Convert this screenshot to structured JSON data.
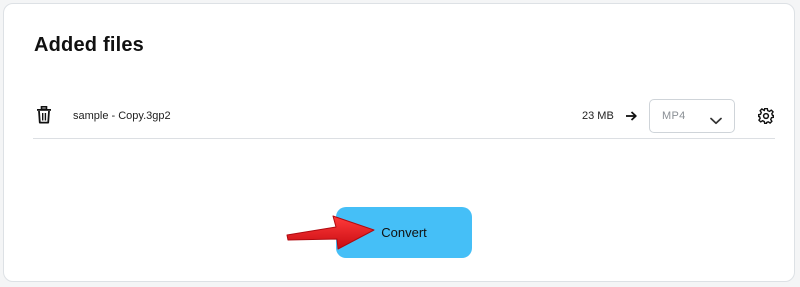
{
  "card": {
    "title": "Added files"
  },
  "file": {
    "name": "sample - Copy.3gp2",
    "size": "23 MB",
    "format": {
      "selected": "MP4"
    }
  },
  "actions": {
    "convert_label": "Convert"
  },
  "icons": {
    "delete": "trash-icon",
    "to": "arrow-right-icon",
    "dropdown": "chevron-down-icon",
    "settings": "gear-icon",
    "annotation": "red-pointer-arrow"
  },
  "colors": {
    "convert_button": "#45bff7",
    "annotation_arrow": "#e8141c"
  }
}
